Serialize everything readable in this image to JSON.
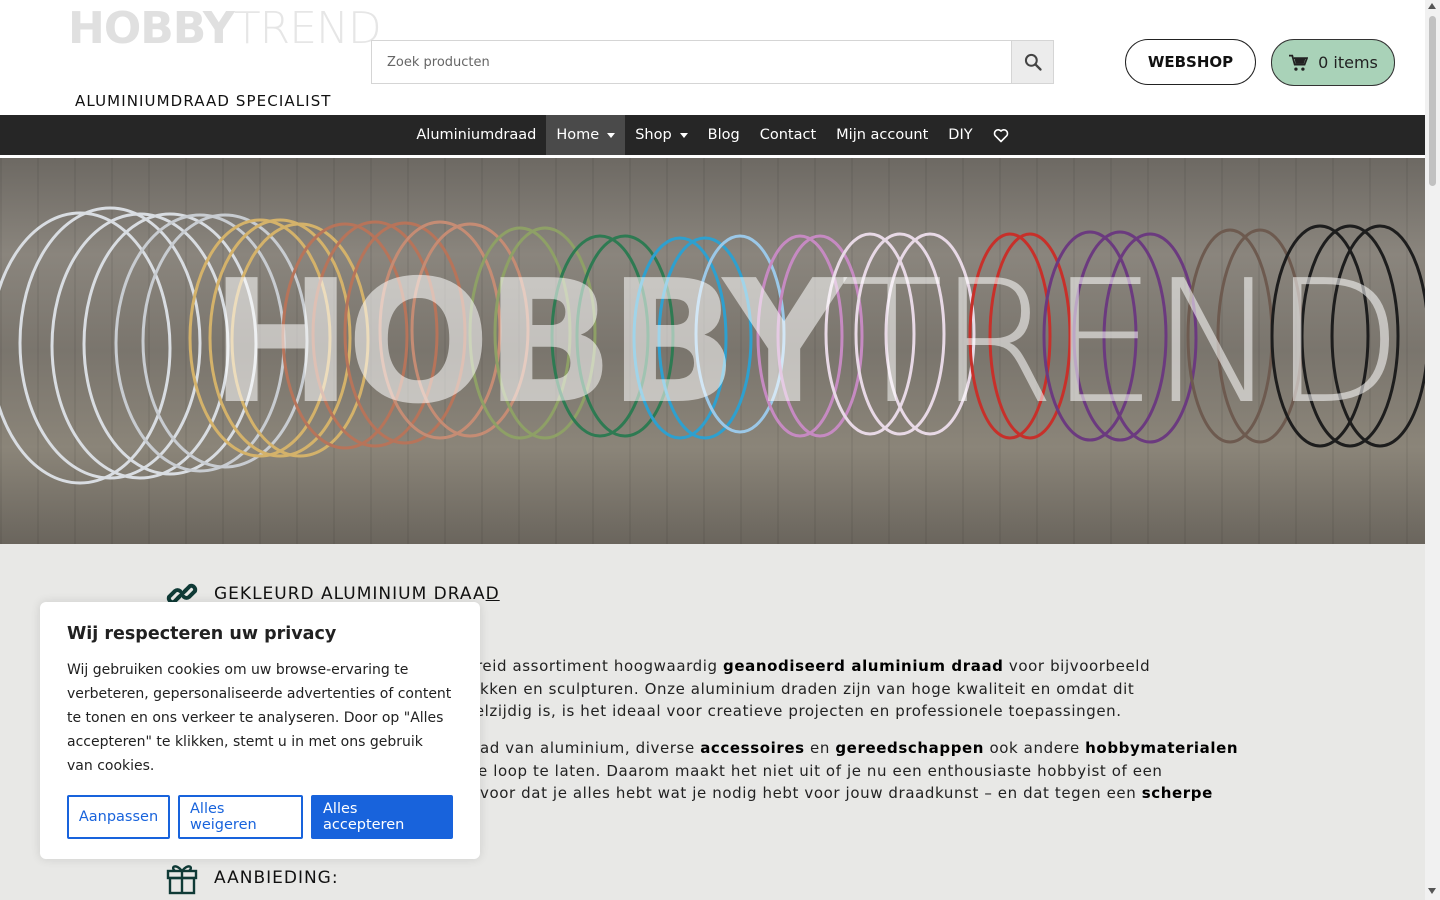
{
  "header": {
    "logo_bold": "HOBBY",
    "logo_light": "TREND",
    "tagline": "ALUMINIUMDRAAD SPECIALIST",
    "search_placeholder": "Zoek producten",
    "webshop_label": "WEBSHOP",
    "cart_label": "0 items"
  },
  "nav": {
    "items": [
      {
        "label": "Aluminiumdraad"
      },
      {
        "label": "Home"
      },
      {
        "label": "Shop"
      },
      {
        "label": "Blog"
      },
      {
        "label": "Contact"
      },
      {
        "label": "Mijn account"
      },
      {
        "label": "DIY"
      }
    ]
  },
  "hero": {
    "overlay_bold": "HOBBY",
    "overlay_light": "TREND"
  },
  "content": {
    "section1_title_main": "GEKLEURD ALUMINIUM DRAA",
    "section1_title_tail": "D",
    "para1": {
      "t1": "ebreid assortiment hoogwaardig ",
      "b1": "geanodiseerd aluminium draad",
      "t2": " voor bijvoorbeeld",
      "line2": "kken en sculpturen. Onze aluminium draden zijn van hoge kwaliteit en omdat dit",
      "line3": "eelzijdig is, is het ideaal voor creatieve projecten en professionele toepassingen."
    },
    "para2": {
      "t1": "ad van aluminium, diverse ",
      "b1": "accessoires",
      "t2": " en ",
      "b2": "gereedschappen",
      "t3": " ook andere ",
      "b3": "hobbymaterialen",
      "line2": "e loop te laten. Daarom maakt het niet uit of je nu een enthousiaste hobbyist of een",
      "line3a": "voor dat je alles hebt wat je nodig hebt voor jouw draadkunst – en dat tegen een ",
      "line3b": "scherpe"
    },
    "section2_title": "AANBIEDING:"
  },
  "cookie": {
    "title": "Wij respecteren uw privacy",
    "body": "Wij gebruiken cookies om uw browse-ervaring te verbeteren, gepersonaliseerde advertenties of content te tonen en ons verkeer te analyseren. Door op \"Alles accepteren\" te klikken, stemt u in met ons gebruik van cookies.",
    "customize": "Aanpassen",
    "reject": "Alles weigeren",
    "accept": "Alles accepteren"
  },
  "colors": {
    "nav_bg": "#262626",
    "cart_bg": "#a9d2b8",
    "cookie_blue": "#1863dc"
  },
  "icons": [
    "search-icon",
    "cart-icon",
    "heart-icon",
    "link-icon",
    "gift-icon"
  ]
}
